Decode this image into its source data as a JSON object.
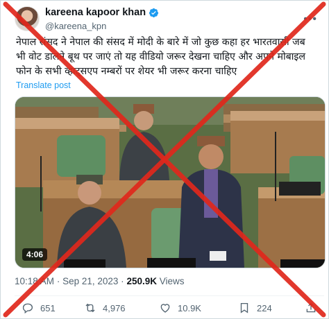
{
  "user": {
    "display_name": "kareena kapoor khan",
    "handle": "@kareena_kpn"
  },
  "tweet": {
    "text": "नेपाल संसद ने नेपाल की संसद में मोदी के बारे में जो कुछ कहा हर भारतवासी जब भी वोट डालने बूथ पर जाएं तो यह वीडियो जरूर देखना चाहिए और अपने मोबाइल फोन के सभी व्हाट्सएप नम्बरों पर शेयर भी जरूर करना चाहिए",
    "translate_label": "Translate post",
    "video_duration": "4:06",
    "time": "10:18 AM",
    "separator": "·",
    "date": "Sep 21, 2023",
    "views": "250.9K",
    "views_label": "Views"
  },
  "actions": {
    "replies": "651",
    "reposts": "4,976",
    "likes": "10.9K",
    "bookmarks": "224"
  },
  "colors": {
    "accent": "#1d9bf0",
    "cross_overlay": "#e0281c",
    "muted": "#536471"
  },
  "icons": [
    "verified-badge-icon",
    "more-icon",
    "reply-icon",
    "repost-icon",
    "like-icon",
    "bookmark-icon",
    "share-icon"
  ]
}
